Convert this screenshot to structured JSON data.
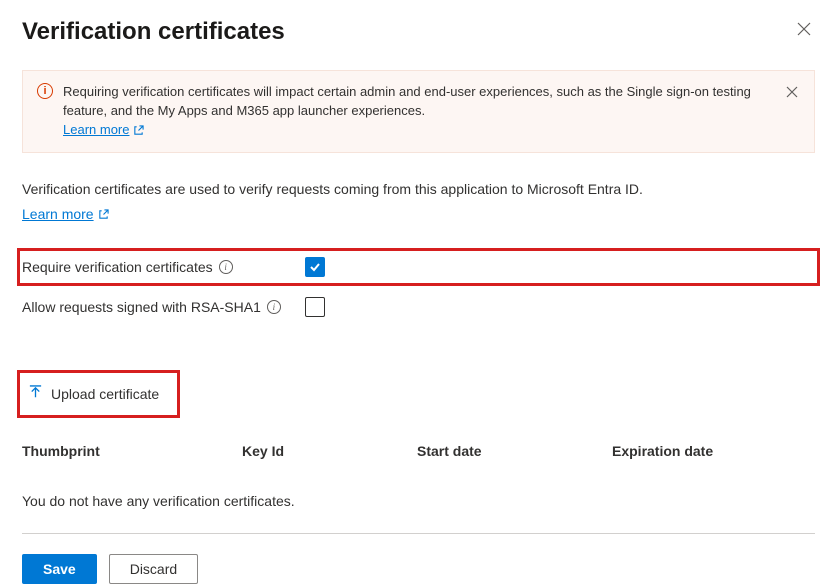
{
  "header": {
    "title": "Verification certificates"
  },
  "banner": {
    "text": "Requiring verification certificates will impact certain admin and end-user experiences, such as the Single sign-on testing feature, and the My Apps and M365 app launcher experiences.",
    "learn_more": "Learn more"
  },
  "description": {
    "text": "Verification certificates are used to verify requests coming from this application to Microsoft Entra ID.",
    "learn_more": "Learn more"
  },
  "options": {
    "require_label": "Require verification certificates",
    "require_checked": true,
    "rsa_label": "Allow requests signed with RSA-SHA1",
    "rsa_checked": false
  },
  "upload": {
    "label": "Upload certificate"
  },
  "table": {
    "headers": {
      "thumbprint": "Thumbprint",
      "key_id": "Key Id",
      "start_date": "Start date",
      "expiration_date": "Expiration date"
    },
    "empty_message": "You do not have any verification certificates."
  },
  "footer": {
    "save": "Save",
    "discard": "Discard"
  }
}
